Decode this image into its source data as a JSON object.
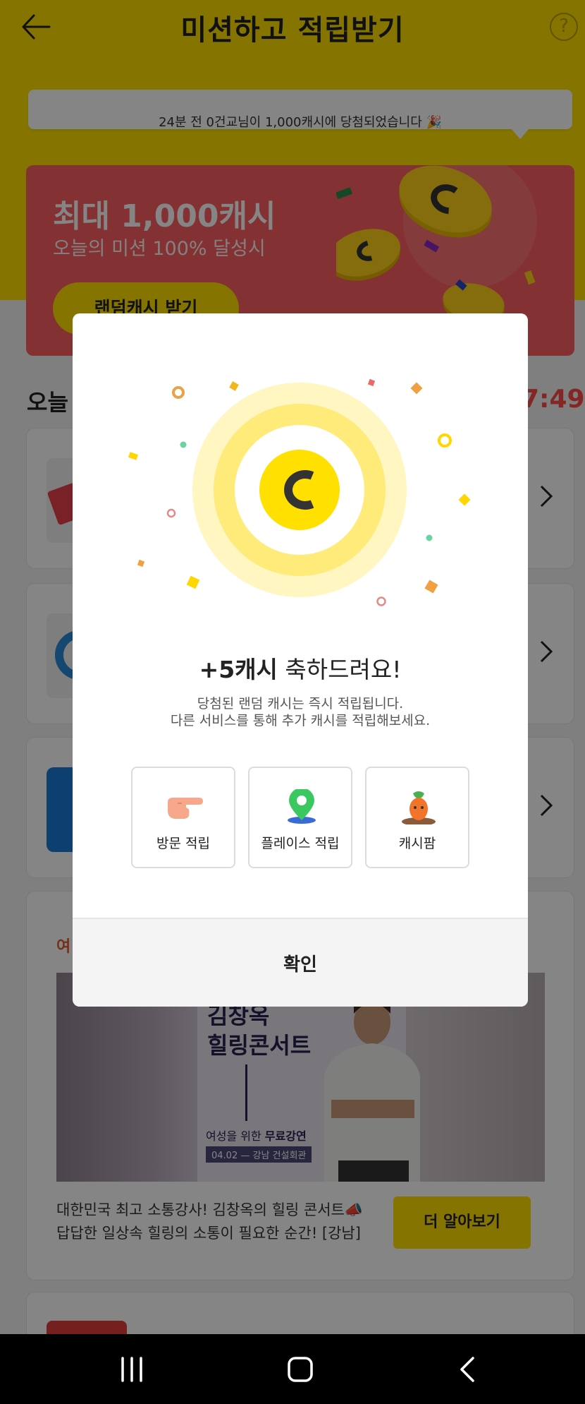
{
  "header": {
    "title": "미션하고 적립받기",
    "back_icon": "arrow-left-icon",
    "help_icon": "question-circle-icon",
    "help_symbol": "?"
  },
  "ticker": {
    "text": "24분 전 0건교님이 1,000캐시에 당첨되었습니다 🎉"
  },
  "banner": {
    "title": "최대 1,000캐시",
    "subtitle": "오늘의 미션 100% 달성시",
    "button_label": "랜덤캐시 받기",
    "colors": {
      "background": "#fb5f60",
      "button": "#ffe000"
    }
  },
  "today": {
    "title": "오늘",
    "countdown": "7:49"
  },
  "ad": {
    "label": "여",
    "poster_title_line1": "김창옥",
    "poster_title_line2": "힐링콘서트",
    "poster_sub_prefix": "여성을 위한 ",
    "poster_sub_strong": "무료강연",
    "poster_date": "04.02",
    "poster_venue": "강남 건설회관",
    "description_line1": "대한민국 최고 소통강사! 김창옥의 힐링 콘서트📣",
    "description_line2": "답답한 일상속 힐링의 소통이 필요한 순간! [강남]",
    "button_label": "더 알아보기"
  },
  "modal": {
    "coin_letter": "C",
    "reward_amount": "+5캐시",
    "reward_suffix": " 축하드려요!",
    "description_line1": "당첨된 랜덤 캐시는 즉시 적립됩니다.",
    "description_line2": "다른 서비스를 통해 추가 캐시를 적립해보세요.",
    "options": [
      {
        "label": "방문 적립",
        "icon": "pointing-hand-icon"
      },
      {
        "label": "플레이스 적립",
        "icon": "map-pin-icon"
      },
      {
        "label": "캐시팜",
        "icon": "carrot-icon"
      }
    ],
    "confirm_label": "확인",
    "colors": {
      "coin": "#ffe000",
      "ring_outer": "#fff6c2",
      "ring_mid": "#ffeb7a"
    }
  },
  "navbar": {
    "recent_icon": "recent-apps-icon",
    "home_icon": "home-icon",
    "back_icon": "nav-back-icon"
  }
}
